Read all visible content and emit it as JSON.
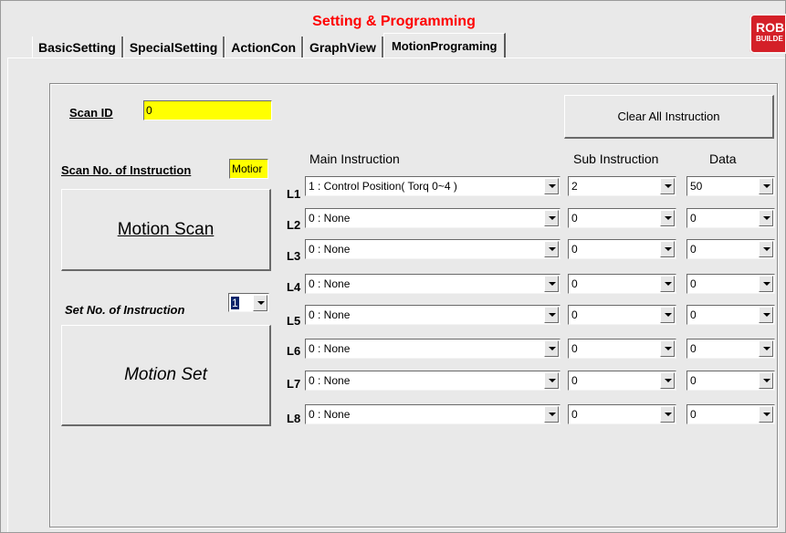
{
  "window": {
    "title": "Setting & Programming",
    "logo": {
      "line1": "ROBI",
      "line2": "BUILDE"
    }
  },
  "tabs": [
    {
      "label": "BasicSetting",
      "active": false
    },
    {
      "label": "SpecialSetting",
      "active": false
    },
    {
      "label": "ActionCon",
      "active": false
    },
    {
      "label": "GraphView",
      "active": false
    },
    {
      "label": "MotionPrograming",
      "active": true
    }
  ],
  "scan": {
    "id_label": "Scan ID",
    "id_value": "0",
    "no_label": "Scan No. of Instruction",
    "no_value": "Motior",
    "button_label": "Motion Scan"
  },
  "set": {
    "no_label": "Set No. of Instruction",
    "no_value": "1",
    "button_label": "Motion Set"
  },
  "clear_button": "Clear All Instruction",
  "columns": {
    "main": "Main Instruction",
    "sub": "Sub Instruction",
    "data": "Data"
  },
  "rows": [
    {
      "label": "L1",
      "main": "1 : Control Position( Torq 0~4 )",
      "sub": "2",
      "data": "50"
    },
    {
      "label": "L2",
      "main": "0 : None",
      "sub": "0",
      "data": "0"
    },
    {
      "label": "L3",
      "main": "0 : None",
      "sub": "0",
      "data": "0"
    },
    {
      "label": "L4",
      "main": "0 : None",
      "sub": "0",
      "data": "0"
    },
    {
      "label": "L5",
      "main": "0 : None",
      "sub": "0",
      "data": "0"
    },
    {
      "label": "L6",
      "main": "0 : None",
      "sub": "0",
      "data": "0"
    },
    {
      "label": "L7",
      "main": "0 : None",
      "sub": "0",
      "data": "0"
    },
    {
      "label": "L8",
      "main": "0 : None",
      "sub": "0",
      "data": "0"
    }
  ],
  "colors": {
    "highlight_field": "#ffff00",
    "title": "#ff0000",
    "logo_bg": "#d42028",
    "window_bg": "#e9e9e9"
  }
}
